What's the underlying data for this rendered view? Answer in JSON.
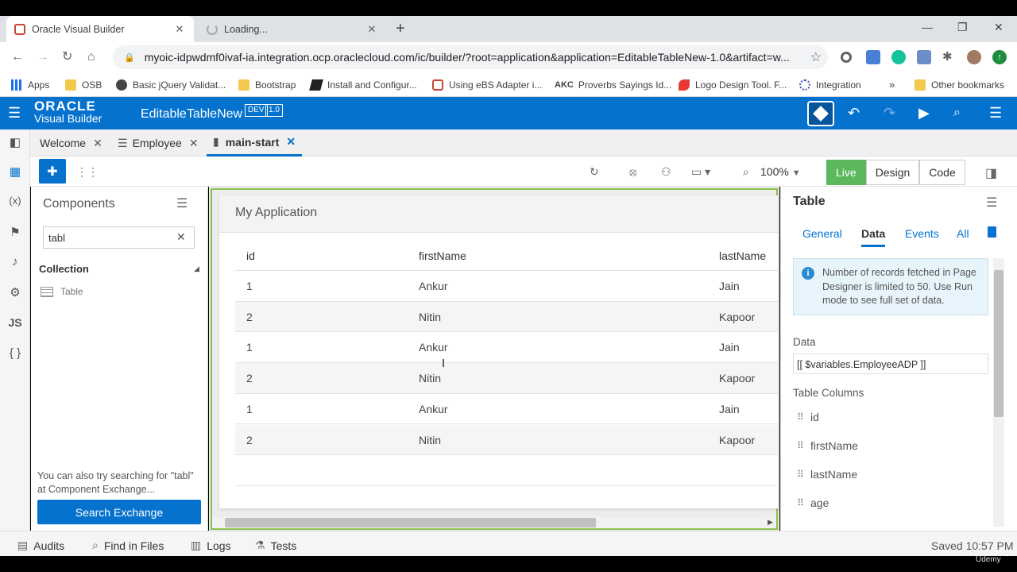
{
  "browser": {
    "tabs": [
      {
        "title": "Oracle Visual Builder"
      },
      {
        "title": "Loading..."
      }
    ],
    "url": "myoic-idpwdmf0ivaf-ia.integration.ocp.oraclecloud.com/ic/builder/?root=application&application=EditableTableNew-1.0&artifact=w...",
    "bookmarks": [
      {
        "label": "Apps"
      },
      {
        "label": "OSB"
      },
      {
        "label": "Basic jQuery Validat..."
      },
      {
        "label": "Bootstrap"
      },
      {
        "label": "Install and Configur..."
      },
      {
        "label": "Using eBS Adapter i..."
      },
      {
        "label": "Proverbs Sayings Id..."
      },
      {
        "label": "Logo Design Tool. F..."
      },
      {
        "label": "Integration"
      },
      {
        "label": "Other bookmarks"
      }
    ],
    "bookmark_chevron": "»",
    "akc_label": "AKC"
  },
  "header": {
    "brand_line1": "ORACLE",
    "brand_line2": "Visual Builder",
    "app_name": "EditableTableNew",
    "badge_env": "DEV",
    "badge_version": "1.0"
  },
  "editor_tabs": [
    {
      "label": "Welcome"
    },
    {
      "label": "Employee"
    },
    {
      "label": "main-start"
    }
  ],
  "toolbar": {
    "zoom": "100%",
    "modes": [
      "Live",
      "Design",
      "Code"
    ]
  },
  "components": {
    "title": "Components",
    "search_value": "tabl",
    "section": "Collection",
    "item": "Table",
    "hint": "You can also try searching for \"tabl\" at Component Exchange...",
    "search_exchange_button": "Search Exchange"
  },
  "rail": {
    "js": "JS",
    "expr": "(x)",
    "braces": "{ }"
  },
  "canvas": {
    "app_title": "My Application",
    "columns": [
      "id",
      "firstName",
      "lastName"
    ],
    "rows": [
      [
        "1",
        "Ankur",
        "Jain"
      ],
      [
        "2",
        "Nitin",
        "Kapoor"
      ],
      [
        "1",
        "Ankur",
        "Jain"
      ],
      [
        "2",
        "Nitin",
        "Kapoor"
      ],
      [
        "1",
        "Ankur",
        "Jain"
      ],
      [
        "2",
        "Nitin",
        "Kapoor"
      ]
    ]
  },
  "properties": {
    "title": "Table",
    "tabs": [
      "General",
      "Data",
      "Events",
      "All"
    ],
    "info": "Number of records fetched in Page Designer is limited to 50. Use Run mode to see full set of data.",
    "data_label": "Data",
    "data_value": "[[ $variables.EmployeeADP ]]",
    "columns_label": "Table Columns",
    "columns": [
      "id",
      "firstName",
      "lastName",
      "age"
    ]
  },
  "status": {
    "items": [
      "Audits",
      "Find in Files",
      "Logs",
      "Tests"
    ],
    "saved": "Saved 10:57 PM"
  },
  "watermark": "Udemy",
  "colors": {
    "oracle_blue": "#0572ce",
    "live_green": "#5cb85c",
    "canvas_border": "#8bc34a"
  }
}
